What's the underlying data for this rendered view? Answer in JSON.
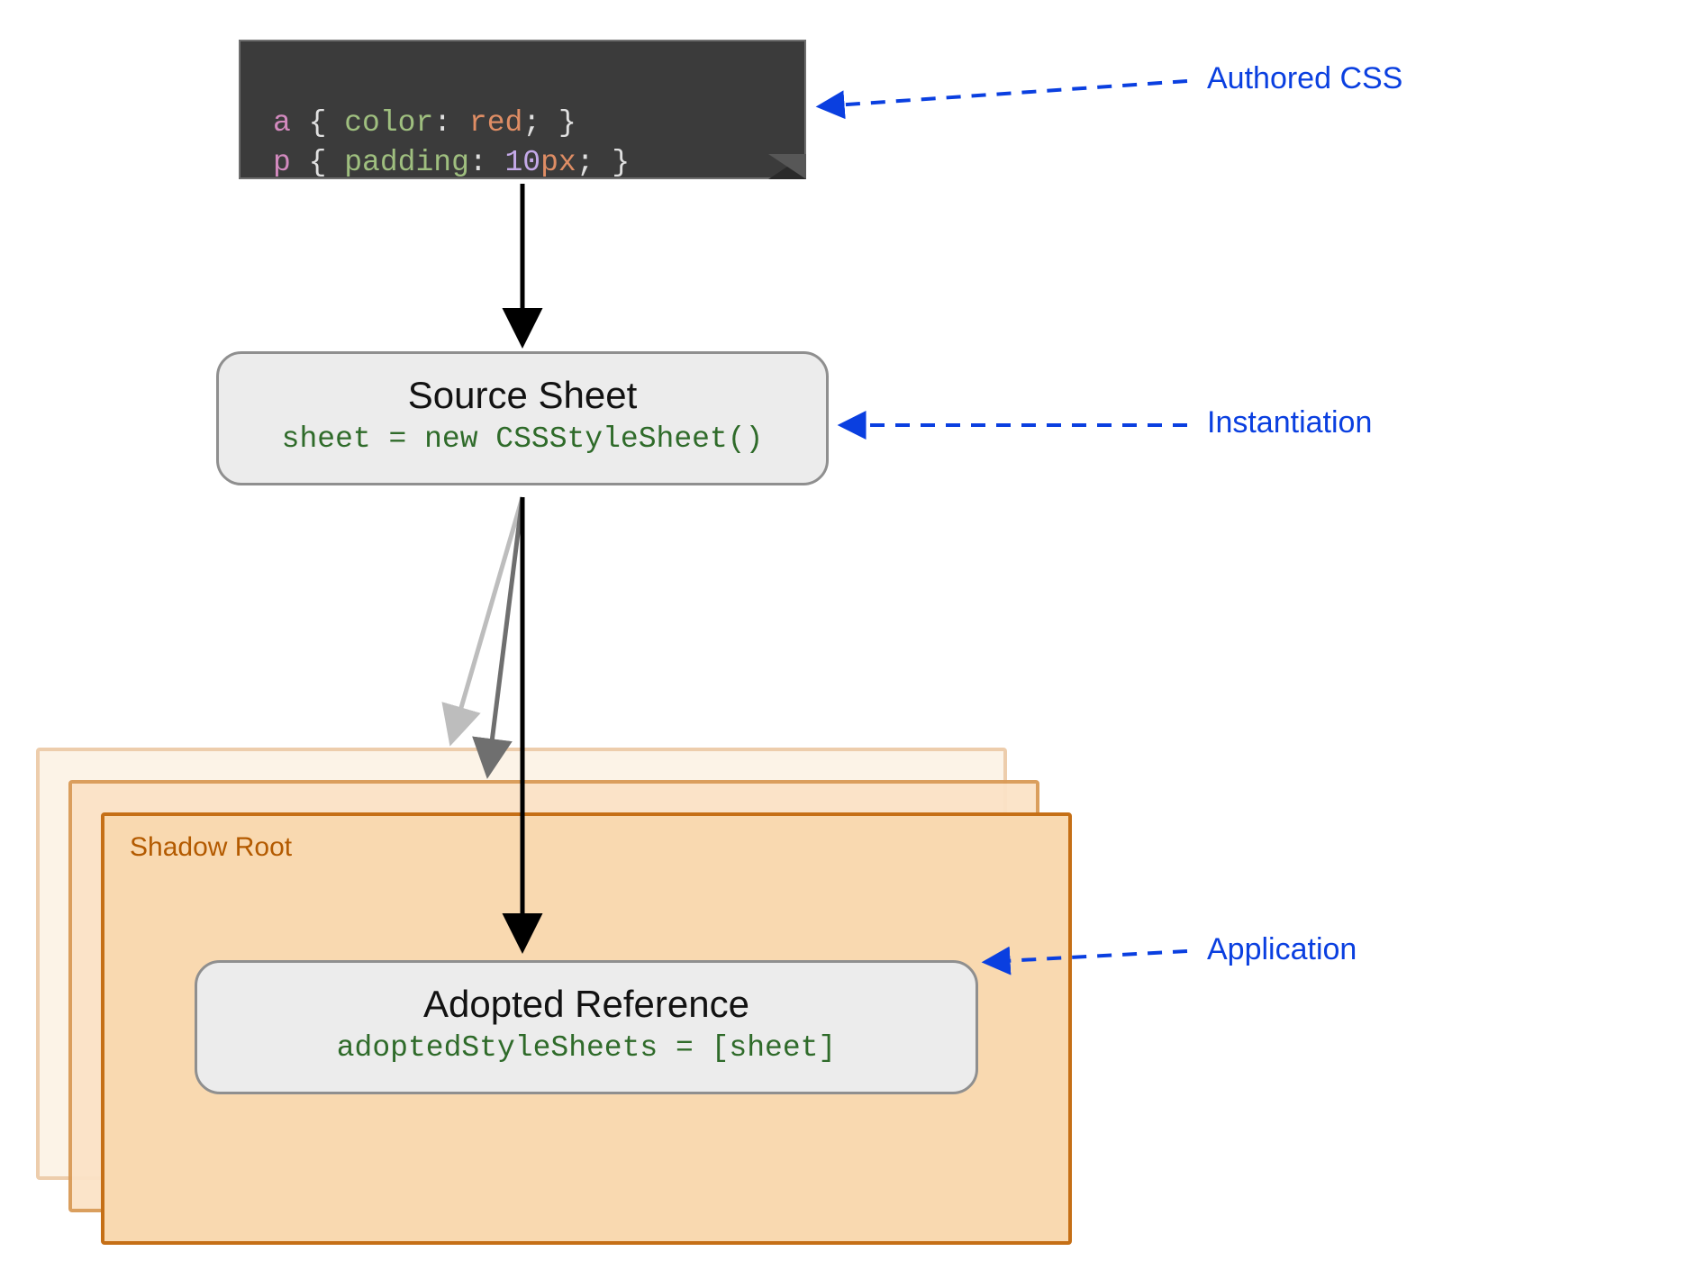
{
  "codeblock": {
    "line1": {
      "selector": "a",
      "brace_open": "{",
      "prop": "color",
      "colon": ":",
      "value_text": "red",
      "semi": ";",
      "brace_close": "}"
    },
    "line2": {
      "selector": "p",
      "brace_open": "{",
      "prop": "padding",
      "colon": ":",
      "value_num": "10",
      "value_unit": "px",
      "semi": ";",
      "brace_close": "}"
    }
  },
  "source_box": {
    "title": "Source Sheet",
    "code": "sheet = new CSSStyleSheet()"
  },
  "adopted_box": {
    "title": "Adopted Reference",
    "code": "adoptedStyleSheets = [sheet]"
  },
  "shadow_label": "Shadow Root",
  "annotations": {
    "authored": "Authored CSS",
    "instantiation": "Instantiation",
    "application": "Application"
  }
}
